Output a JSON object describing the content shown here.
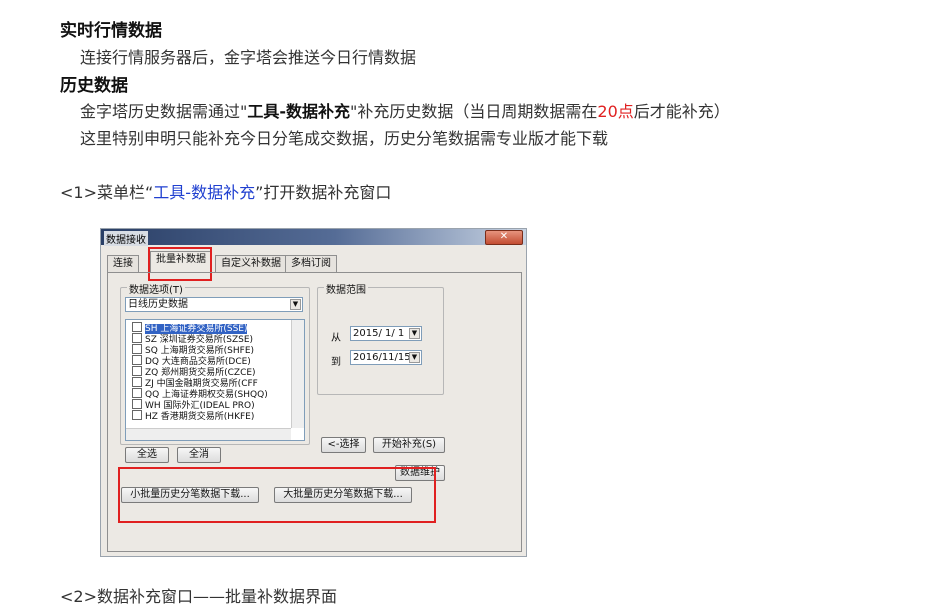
{
  "section1": {
    "heading": "实时行情数据",
    "text": "连接行情服务器后，金字塔会推送今日行情数据"
  },
  "section2": {
    "heading": "历史数据",
    "line1_pre": "金字塔历史数据需通过\"",
    "line1_bold": "工具-数据补充",
    "line1_mid": "\"补充历史数据（当日周期数据需在",
    "line1_red": "20点",
    "line1_post": "后才能补充）",
    "line2": "这里特别申明只能补充今日分笔成交数据，历史分笔数据需专业版才能下载"
  },
  "step1": {
    "pre": "<1>菜单栏“",
    "link": "工具-数据补充",
    "post": "”打开数据补充窗口"
  },
  "dialog": {
    "title": "数据接收",
    "close": "✕",
    "tabs": [
      "连接",
      "批量补数据",
      "自定义补数据",
      "多档订阅"
    ],
    "data_options_label": "数据选项(T)",
    "data_option_selected": "日线历史数据",
    "markets": [
      "SH 上海证券交易所(SSE)",
      "SZ 深圳证券交易所(SZSE)",
      "SQ 上海期货交易所(SHFE)",
      "DQ 大连商品交易所(DCE)",
      "ZQ 郑州期货交易所(CZCE)",
      "ZJ 中国金融期货交易所(CFF",
      "QQ 上海证券期权交易(SHQQ)",
      "WH 国际外汇(IDEAL PRO)",
      "HZ 香港期货交易所(HKFE)"
    ],
    "select_all": "全选",
    "select_all_markets": "全消",
    "range_label": "数据范围",
    "from_label": "从",
    "from_date": "2015/ 1/ 1",
    "to_label": "到",
    "to_date": "2016/11/15",
    "select_button": "<-选择",
    "start_button": "开始补充(S)",
    "maintain_button": "数据维护",
    "small_batch_button": "小批量历史分笔数据下载...",
    "large_batch_button": "大批量历史分笔数据下载..."
  },
  "footer_partial": "<2>数据补充窗口——批量补数据界面"
}
